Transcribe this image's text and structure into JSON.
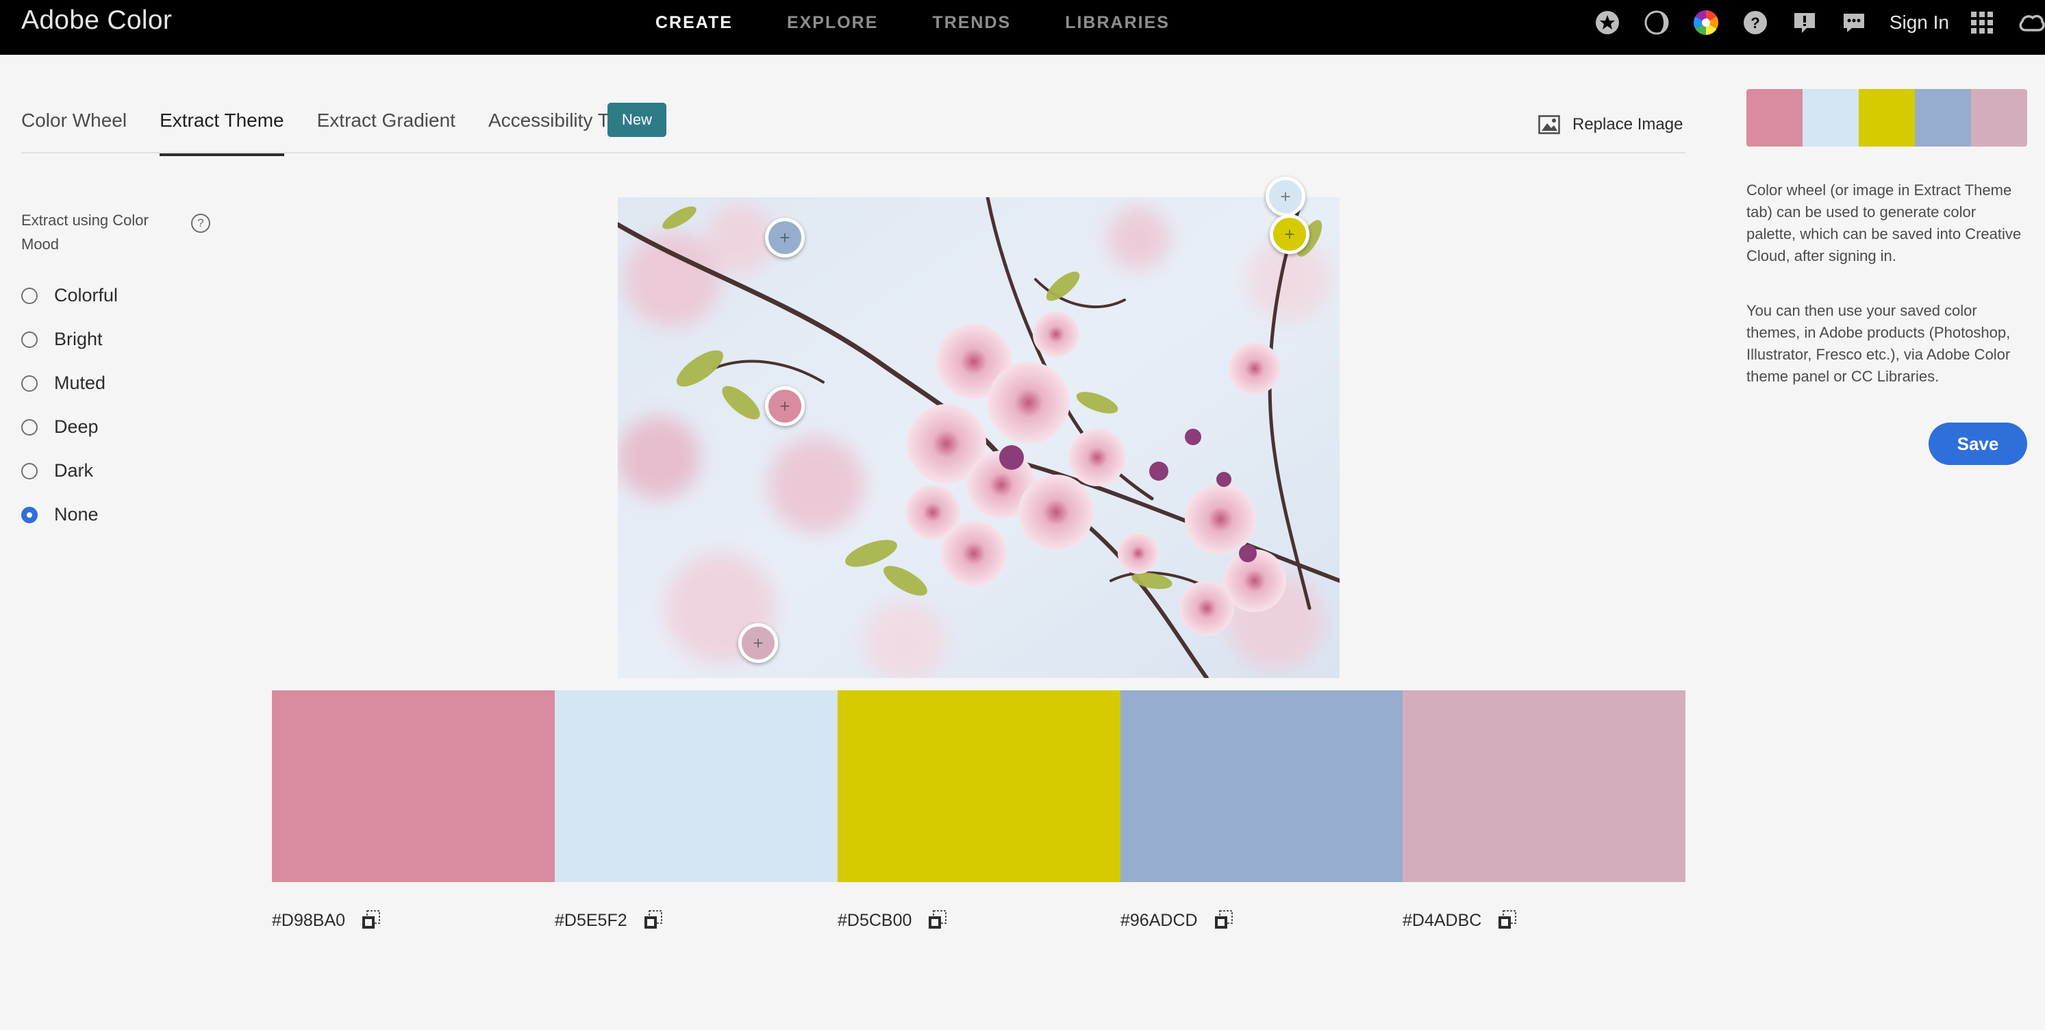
{
  "app": {
    "brand": "Adobe Color"
  },
  "topnav": {
    "items": [
      "CREATE",
      "EXPLORE",
      "TRENDS",
      "LIBRARIES"
    ],
    "active": "CREATE"
  },
  "topbar": {
    "icons": [
      "star-icon",
      "moon-icon",
      "color-wheel-icon",
      "help-icon",
      "feedback-icon",
      "chat-icon"
    ],
    "sign_in": "Sign In"
  },
  "tabs": {
    "items": [
      "Color Wheel",
      "Extract Theme",
      "Extract Gradient",
      "Accessibility Tools"
    ],
    "active": "Extract Theme",
    "new_badge": "New"
  },
  "toolbar": {
    "replace_image": "Replace Image"
  },
  "mood": {
    "title": "Extract using Color Mood",
    "help": "?",
    "options": [
      "Colorful",
      "Bright",
      "Muted",
      "Deep",
      "Dark",
      "None"
    ],
    "selected": "None"
  },
  "theme": {
    "colors": [
      "#D98BA0",
      "#D5E5F2",
      "#D5CB00",
      "#96ADCD",
      "#D4ADBC"
    ],
    "labels": [
      "#D98BA0",
      "#D5E5F2",
      "#D5CB00",
      "#96ADCD",
      "#D4ADBC"
    ]
  },
  "sidebar": {
    "desc1": "Color wheel (or image in Extract Theme tab) can be used to generate color palette, which can be saved into Creative Cloud, after signing in.",
    "desc2": "You can then use your saved color themes, in Adobe products (Photoshop, Illustrator, Fresco etc.), via Adobe Color theme panel or CC Libraries.",
    "save": "Save"
  },
  "colors": {
    "accent": "#2F6FD9",
    "badge": "#2D7B87",
    "topbar": "#000000"
  }
}
